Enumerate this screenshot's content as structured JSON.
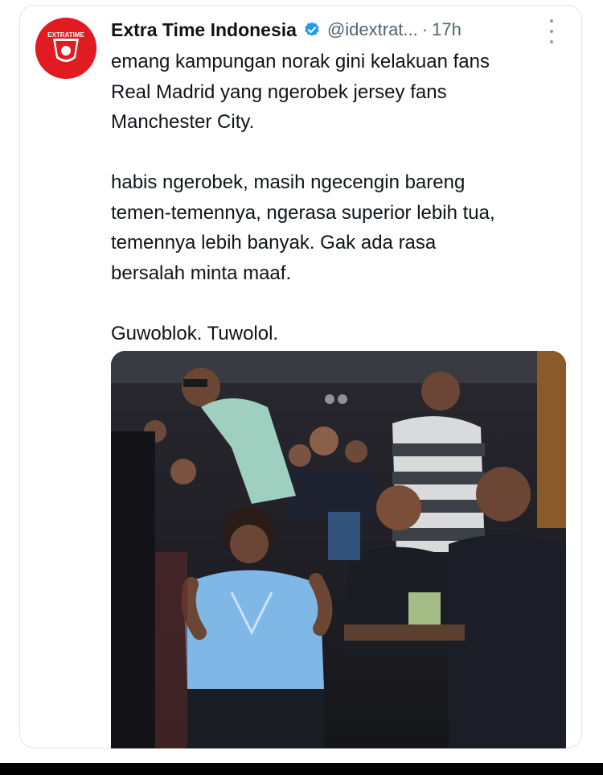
{
  "post": {
    "author_name": "Extra Time Indonesia",
    "handle": "@idextrat...",
    "separator": "·",
    "time": "17h",
    "avatar_text": "EXTRATIME",
    "text_lines": [
      "emang kampungan norak gini kelakuan fans",
      "Real Madrid yang ngerobek jersey fans",
      "Manchester City.",
      "",
      "habis ngerobek, masih ngecengin bareng",
      "temen-temennya, ngerasa superior lebih tua,",
      "temennya lebih banyak. Gak ada rasa",
      "bersalah minta maaf.",
      "",
      "Guwoblok. Tuwolol."
    ],
    "media": {
      "type": "video-still",
      "description_icon": "video-frame"
    }
  },
  "colors": {
    "text": "#0f1419",
    "secondary": "#536471",
    "verified": "#1d9bf0",
    "avatar_bg": "#e11b22"
  },
  "icons": [
    "verified-badge-icon",
    "more-options-icon"
  ]
}
